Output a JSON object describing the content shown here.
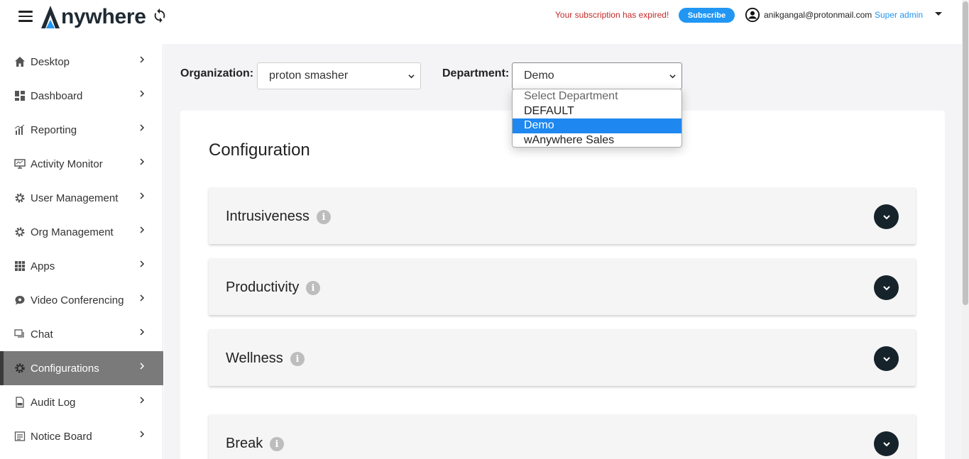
{
  "header": {
    "logo_text": "nywhere",
    "subscription_message": "Your subscription has expired!",
    "subscribe_label": "Subscribe",
    "user_email": "anikgangal@protonmail.com",
    "user_role": "Super admin"
  },
  "sidebar": {
    "items": [
      {
        "label": "Desktop",
        "icon": "home-icon"
      },
      {
        "label": "Dashboard",
        "icon": "dashboard-icon"
      },
      {
        "label": "Reporting",
        "icon": "bar-chart-icon"
      },
      {
        "label": "Activity Monitor",
        "icon": "monitor-icon"
      },
      {
        "label": "User Management",
        "icon": "gear-icon"
      },
      {
        "label": "Org Management",
        "icon": "gear-icon"
      },
      {
        "label": "Apps",
        "icon": "apps-grid-icon"
      },
      {
        "label": "Video Conferencing",
        "icon": "chat-bubble-icon"
      },
      {
        "label": "Chat",
        "icon": "chat-icon"
      },
      {
        "label": "Configurations",
        "icon": "settings-icon",
        "active": true
      },
      {
        "label": "Audit Log",
        "icon": "log-icon"
      },
      {
        "label": "Notice Board",
        "icon": "notice-icon"
      }
    ]
  },
  "filters": {
    "organization_label": "Organization:",
    "organization_value": "proton smasher",
    "department_label": "Department:",
    "department_value": "Demo",
    "department_options": [
      "Select Department",
      "DEFAULT",
      "Demo",
      "wAnywhere Sales"
    ],
    "department_selected_index": 2
  },
  "main": {
    "title": "Configuration",
    "sections": [
      {
        "title": "Intrusiveness"
      },
      {
        "title": "Productivity"
      },
      {
        "title": "Wellness"
      },
      {
        "title": "Break"
      }
    ]
  },
  "colors": {
    "accent": "#2196f3",
    "expired_text": "#c62828",
    "active_nav_bg": "#7a7a7a",
    "dropdown_selected": "#1e88f0",
    "expand_button": "#16232b"
  }
}
